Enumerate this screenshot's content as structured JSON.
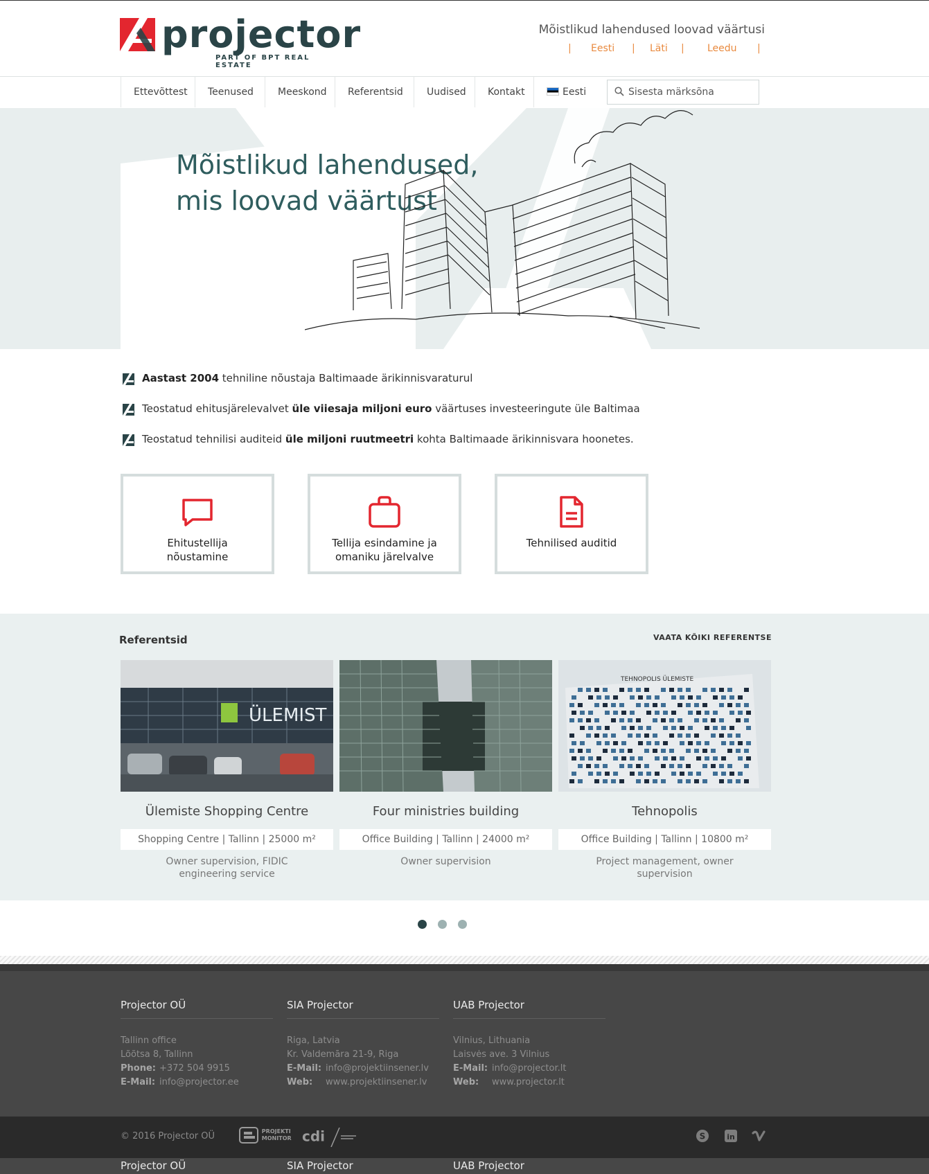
{
  "header": {
    "logo_text": "projector",
    "logo_sub": "PART OF BPT REAL ESTATE",
    "tagline": "Mõistlikud lahendused loovad väärtusi",
    "languages": [
      "Eesti",
      "Läti",
      "Leedu"
    ],
    "lang_sep": "|"
  },
  "nav": {
    "items": [
      "Ettevõttest",
      "Teenused",
      "Meeskond",
      "Referentsid",
      "Uudised",
      "Kontakt"
    ],
    "language": "Eesti",
    "search_placeholder": "Sisesta märksõna"
  },
  "hero": {
    "title_line1": "Mõistlikud lahendused,",
    "title_line2": "mis loovad väärtust"
  },
  "facts": [
    {
      "bold": "Aastast 2004",
      "before": "",
      "after": " tehniline nõustaja Baltimaade ärikinnisvaraturul"
    },
    {
      "before": "Teostatud ehitusjärelevalvet ",
      "bold": "üle viiesaja miljoni euro",
      "after": " väärtuses investeeringute üle Baltimaa"
    },
    {
      "before": "Teostatud tehnilisi auditeid ",
      "bold": "üle miljoni ruutmeetri",
      "after": " kohta Baltimaade ärikinnisvara hoonetes."
    }
  ],
  "services": [
    {
      "icon": "chat-icon",
      "label": "Ehitustellija nõustamine"
    },
    {
      "icon": "briefcase-icon",
      "label": "Tellija esindamine ja omaniku järelvalve"
    },
    {
      "icon": "document-icon",
      "label": "Tehnilised auditid"
    }
  ],
  "references": {
    "title": "Referentsid",
    "view_all": "VAATA KÕIKI REFERENTSE",
    "items": [
      {
        "name": "Ülemiste Shopping Centre",
        "meta": "Shopping Centre | Tallinn | 25000 m²",
        "desc": "Owner supervision, FIDIC engineering service",
        "sign": "ÜLEMIST"
      },
      {
        "name": "Four ministries building",
        "meta": "Office Building | Tallinn | 24000 m²",
        "desc": "Owner supervision"
      },
      {
        "name": "Tehnopolis",
        "meta": "Office Building | Tallinn | 10800 m²",
        "desc": "Project management, owner supervision",
        "sign": "TEHNOPOLIS ÜLEMISTE"
      }
    ],
    "slider_pages": 3,
    "active_page": 1
  },
  "footer": {
    "columns": [
      {
        "title": "Projector OÜ",
        "line1": "Tallinn office",
        "line2": "Lõõtsa 8, Tallinn",
        "label3": "Phone:",
        "value3": "+372 504 9915",
        "label4": "E-Mail:",
        "value4": "info@projector.ee"
      },
      {
        "title": "SIA Projector",
        "line1": "Riga, Latvia",
        "line2": "Kr. Valdemāra 21-9, Riga",
        "label3": "E-Mail:",
        "value3": "info@projektiinsener.lv",
        "label4": "Web:",
        "value4": "www.projektiinsener.lv"
      },
      {
        "title": "UAB Projector",
        "line1": "Vilnius, Lithuania",
        "line2": "Laisvės ave. 3 Vilnius",
        "label3": "E-Mail:",
        "value3": "info@projector.lt",
        "label4": "Web:",
        "value4": "www.projector.lt"
      }
    ],
    "copyright": "© 2016 Projector OÜ",
    "partners": [
      "PROJEKTI MONITOR",
      "cdi"
    ],
    "social": [
      "skype-icon",
      "linkedin-icon",
      "vimeo-icon"
    ]
  },
  "colors": {
    "brand_dark": "#2a4447",
    "accent_red": "#e3262f",
    "lang_orange": "#e98a3f",
    "refs_bg": "#eaf0f0"
  }
}
